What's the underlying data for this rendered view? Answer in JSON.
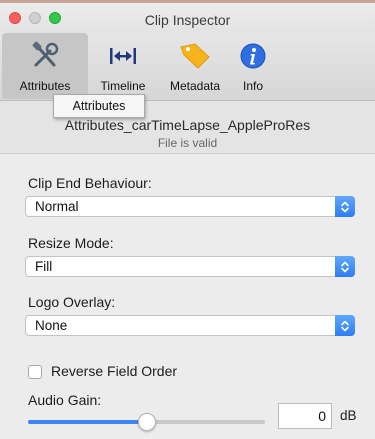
{
  "window": {
    "title": "Clip Inspector"
  },
  "toolbar": {
    "items": [
      {
        "label": "Attributes",
        "icon": "wrench-screwdriver-icon",
        "selected": true
      },
      {
        "label": "Timeline",
        "icon": "timeline-arrows-icon",
        "selected": false
      },
      {
        "label": "Metadata",
        "icon": "tag-icon",
        "selected": false
      },
      {
        "label": "Info",
        "icon": "info-icon",
        "selected": false
      }
    ]
  },
  "tooltip": {
    "text": "Attributes"
  },
  "file": {
    "name": "Attributes_carTimeLapse_AppleProRes",
    "status": "File is valid"
  },
  "fields": {
    "clip_end": {
      "label": "Clip End Behaviour:",
      "value": "Normal"
    },
    "resize_mode": {
      "label": "Resize Mode:",
      "value": "Fill"
    },
    "logo_overlay": {
      "label": "Logo Overlay:",
      "value": "None"
    }
  },
  "reverse_field_order": {
    "label": "Reverse Field Order",
    "checked": false
  },
  "audio_gain": {
    "label": "Audio Gain:",
    "value": "0",
    "unit": "dB",
    "slider_fraction": 0.5
  },
  "colors": {
    "accent": "#3b86f7",
    "close": "#fc605c",
    "maximize": "#34c84a"
  }
}
